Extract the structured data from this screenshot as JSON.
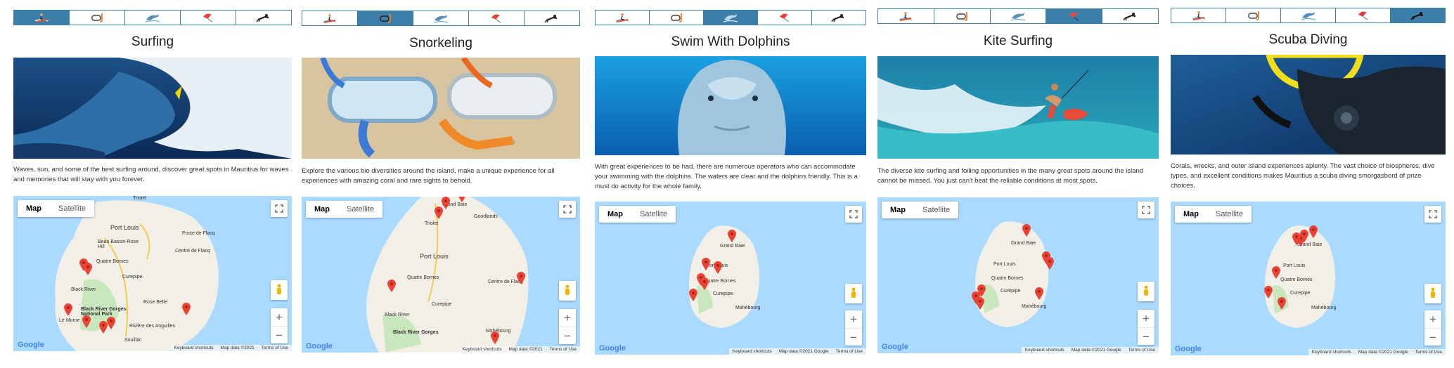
{
  "tab_icons": [
    "surfing-icon",
    "snorkel-icon",
    "dolphin-icon",
    "kite-surfing-icon",
    "scuba-diver-icon"
  ],
  "colors": {
    "tab_border": "#3a7ea5",
    "tab_active": "#3c7fa8",
    "marker": "#ea4335",
    "water": "#aadaff",
    "land": "#f2efe6",
    "forest": "#c9e7bd"
  },
  "panels": [
    {
      "title": "Surfing",
      "description": "Waves, sun, and some of the best surfing around, discover great spots in Mauritius for waves and memories that will stay with you forever.",
      "map": {
        "map_label": "Map",
        "satellite_label": "Satellite",
        "google_label": "Google",
        "shortcuts_label": "Keyboard shortcuts",
        "mapdata_label": "Map data ©2021",
        "terms_label": "Terms of Use",
        "places": [
          "Triolet",
          "Port Louis",
          "Beau Bassin-Rose Hill",
          "Quatre Bornes",
          "Curepipe",
          "Black River",
          "Black River Gorges National Park",
          "Rose Belle",
          "Rivière des Anguilles",
          "Le Morne",
          "Souillac",
          "Centre de Flacq",
          "Poste de Flacq"
        ]
      }
    },
    {
      "title": "Snorkeling",
      "description": "Explore the various bio diversities around the island, make a unique experience for all experiences with amazing coral and rare sights to behold.",
      "map": {
        "map_label": "Map",
        "satellite_label": "Satellite",
        "google_label": "Google",
        "shortcuts_label": "Keyboard shortcuts",
        "mapdata_label": "Map data ©2021",
        "terms_label": "Terms of Use",
        "places": [
          "Grand Baie",
          "Goodlands",
          "Triolet",
          "Port Louis",
          "Quatre Bornes",
          "Black River",
          "Curepipe",
          "Black River Gorges",
          "Centre de Flacq",
          "Mahébourg"
        ]
      }
    },
    {
      "title": "Swim With Dolphins",
      "description": "With great experiences to be had, there are numerous operators who can accommodate your swimming with the dolphins. The waters are clear and the dolphins friendly. This is a must do activity for the whole family.",
      "map": {
        "map_label": "Map",
        "satellite_label": "Satellite",
        "google_label": "Google",
        "shortcuts_label": "Keyboard shortcuts",
        "mapdata_label": "Map data ©2021 Google",
        "terms_label": "Terms of Use",
        "places": [
          "Grand Baie",
          "Port Louis",
          "Quatre Bornes",
          "Curepipe",
          "Mahébourg"
        ]
      }
    },
    {
      "title": "Kite Surfing",
      "description": "The diverse kite surfing and foiling opportunities in the many great spots around the island cannot be missed. You just can't beat the reliable conditions at most spots.",
      "map": {
        "map_label": "Map",
        "satellite_label": "Satellite",
        "google_label": "Google",
        "shortcuts_label": "Keyboard shortcuts",
        "mapdata_label": "Map data ©2021 Google",
        "terms_label": "Terms of Use",
        "places": [
          "Grand Baie",
          "Port Louis",
          "Quatre Bornes",
          "Curepipe",
          "Mahébourg"
        ]
      }
    },
    {
      "title": "Scuba Diving",
      "description": "Corals, wrecks, and outer island experiences aplenty. The vast choice of biospheres, dive types, and excellent conditions makes Mauritius a scuba diving smorgasbord of prize choices.",
      "map": {
        "map_label": "Map",
        "satellite_label": "Satellite",
        "google_label": "Google",
        "shortcuts_label": "Keyboard shortcuts",
        "mapdata_label": "Map data ©2021 Google",
        "terms_label": "Terms of Use",
        "places": [
          "Grand Baie",
          "Port Louis",
          "Quatre Bornes",
          "Curepipe",
          "Mahébourg"
        ]
      }
    }
  ]
}
